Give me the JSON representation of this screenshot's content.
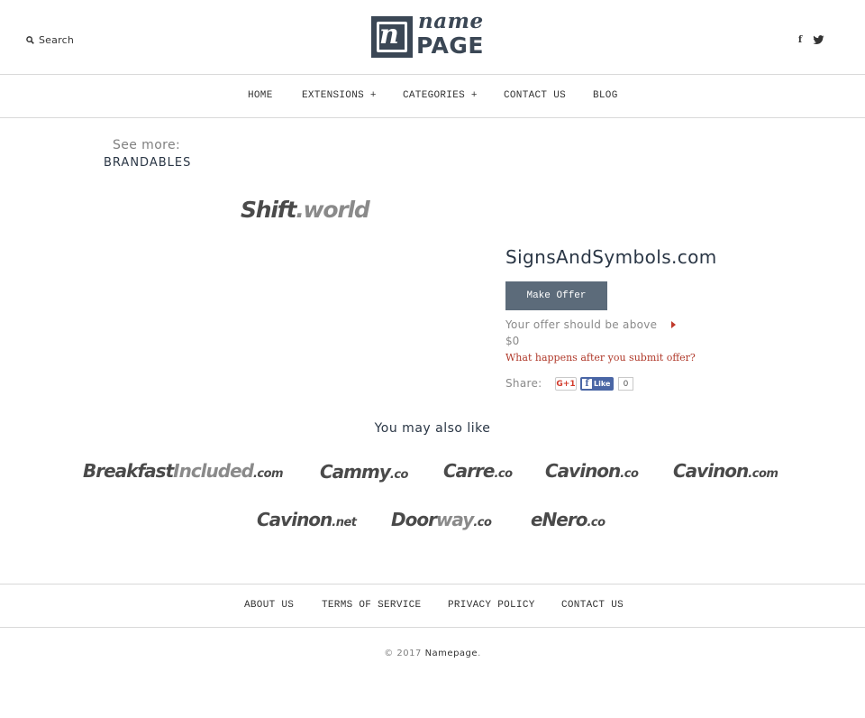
{
  "header": {
    "search_label": "Search",
    "search_icon": "search-icon",
    "logo": {
      "top": "name",
      "bottom": "PAGE",
      "letter": "n"
    },
    "social": {
      "facebook": "f",
      "twitter_icon": "twitter-icon"
    }
  },
  "nav": {
    "items": [
      {
        "label": "HOME"
      },
      {
        "label": "EXTENSIONS +"
      },
      {
        "label": "CATEGORIES +"
      },
      {
        "label": "CONTACT US"
      },
      {
        "label": "BLOG"
      }
    ]
  },
  "sidebar": {
    "see_more_label": "See more:",
    "see_more_link": "BRANDABLES"
  },
  "domain_logo": {
    "part1": "Shift",
    "part2": ".world"
  },
  "offer": {
    "domain": "SignsAndSymbols.com",
    "button": "Make Offer",
    "hint": "Your offer should be above",
    "amount": "$0",
    "help_link": "What happens after you submit offer?",
    "share_label": "Share:",
    "gplus": "G+1",
    "fb_like": "Like",
    "fb_icon": "f",
    "fb_count": "0"
  },
  "related": {
    "heading": "You may also like",
    "items": [
      {
        "a": "Breakfast",
        "b": "Included",
        "tld": ".com"
      },
      {
        "a": "Cammy",
        "b": "",
        "tld": ".co"
      },
      {
        "a": "Carre",
        "b": "",
        "tld": ".co"
      },
      {
        "a": "Cavinon",
        "b": "",
        "tld": ".co"
      },
      {
        "a": "Cavinon",
        "b": "",
        "tld": ".com"
      },
      {
        "a": "Cavinon",
        "b": "",
        "tld": ".net"
      },
      {
        "a": "Door",
        "b": "way",
        "tld": ".co"
      },
      {
        "a": "eNero",
        "b": "",
        "tld": ".co"
      }
    ]
  },
  "footer": {
    "items": [
      {
        "label": "ABOUT US"
      },
      {
        "label": "TERMS OF SERVICE"
      },
      {
        "label": "PRIVACY POLICY"
      },
      {
        "label": "CONTACT US"
      }
    ],
    "copyright_prefix": "© 2017",
    "copyright_brand": "Namepage",
    "copyright_suffix": "."
  },
  "colors": {
    "brand_dark": "#3b4755",
    "button": "#5c6b7a",
    "link_red": "#b0392a",
    "facebook": "#4a66a5"
  }
}
